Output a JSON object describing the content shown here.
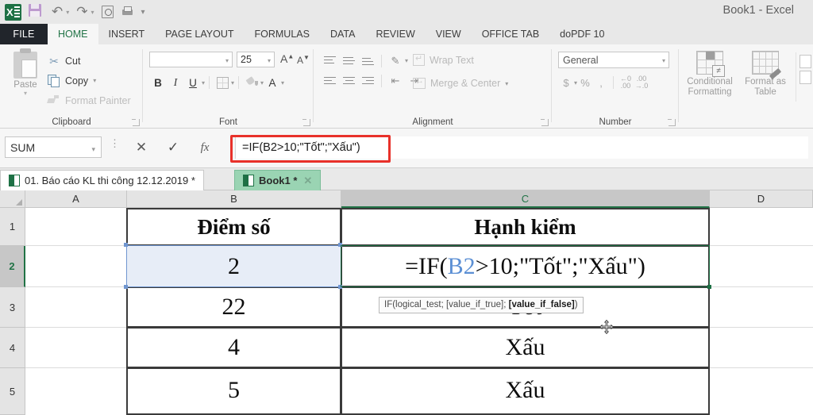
{
  "window": {
    "title": "Book1 - Excel",
    "quick_access": [
      {
        "name": "save",
        "icon": "save-icon"
      },
      {
        "name": "undo",
        "icon": "undo-icon"
      },
      {
        "name": "redo",
        "icon": "redo-icon"
      },
      {
        "name": "print-preview",
        "icon": "print-preview-icon"
      },
      {
        "name": "dopdf-print",
        "icon": "printer-icon"
      },
      {
        "name": "customize",
        "icon": "chevron-down-icon"
      }
    ]
  },
  "ribbon": {
    "file_tab": "FILE",
    "tabs": [
      {
        "label": "HOME",
        "active": true
      },
      {
        "label": "INSERT",
        "active": false
      },
      {
        "label": "PAGE LAYOUT",
        "active": false
      },
      {
        "label": "FORMULAS",
        "active": false
      },
      {
        "label": "DATA",
        "active": false
      },
      {
        "label": "REVIEW",
        "active": false
      },
      {
        "label": "VIEW",
        "active": false
      },
      {
        "label": "OFFICE TAB",
        "active": false
      },
      {
        "label": "doPDF 10",
        "active": false
      }
    ],
    "clipboard": {
      "group_label": "Clipboard",
      "paste": "Paste",
      "cut": "Cut",
      "copy": "Copy",
      "format_painter": "Format Painter"
    },
    "font": {
      "group_label": "Font",
      "font_name": "",
      "font_name_placeholder": "",
      "font_size": "25",
      "bold": "B",
      "italic": "I",
      "underline": "U",
      "grow_font": "A",
      "shrink_font": "A",
      "font_color": "A"
    },
    "alignment": {
      "group_label": "Alignment",
      "wrap_text": "Wrap Text",
      "merge_center": "Merge & Center"
    },
    "number": {
      "group_label": "Number",
      "format": "General",
      "currency": "$",
      "percent": "%",
      "comma": ",",
      "increase_decimal": ".00",
      "decrease_decimal": ".00"
    },
    "styles": {
      "conditional_formatting_line1": "Conditional",
      "conditional_formatting_line2": "Formatting",
      "format_as_table_line1": "Format as",
      "format_as_table_line2": "Table"
    }
  },
  "formula_bar": {
    "name_box": "SUM",
    "cancel": "✕",
    "enter": "✓",
    "insert_function": "fx",
    "formula": "=IF(B2>10;\"Tốt\";\"Xấu\")",
    "highlight_color": "#e8312a"
  },
  "document_tabs": [
    {
      "label": "01. Báo cáo KL thi công 12.12.2019 *",
      "active": false
    },
    {
      "label": "Book1 *",
      "active": true,
      "close": "✕"
    }
  ],
  "spreadsheet": {
    "columns": [
      {
        "label": "A",
        "selected": false
      },
      {
        "label": "B",
        "selected": false
      },
      {
        "label": "C",
        "selected": true
      },
      {
        "label": "D",
        "selected": false
      }
    ],
    "rows": [
      {
        "label": "1",
        "selected": false
      },
      {
        "label": "2",
        "selected": true
      },
      {
        "label": "3",
        "selected": false
      },
      {
        "label": "4",
        "selected": false
      },
      {
        "label": "5",
        "selected": false
      }
    ],
    "cells": {
      "b1": "Điểm số",
      "c1": "Hạnh kiểm",
      "b2": "2",
      "c2_editing": "=IF(B2>10;\"Tốt\";\"Xấu\")",
      "c2_ref": "B2",
      "c2_prefix": "=IF(",
      "c2_suffix": ">10;\"Tốt\";\"Xấu\")",
      "b3": "22",
      "c3": "Tốt",
      "b4": "4",
      "c4": "Xấu",
      "b5": "5",
      "c5": "Xấu"
    },
    "active_cell": "C2",
    "referenced_cell": "B2",
    "selection_color": "#1e7145",
    "reference_color": "#7096d0"
  },
  "tooltip": {
    "prefix": "IF(logical_test; [value_if_true]; ",
    "bold": "[value_if_false]",
    "suffix": ")"
  }
}
